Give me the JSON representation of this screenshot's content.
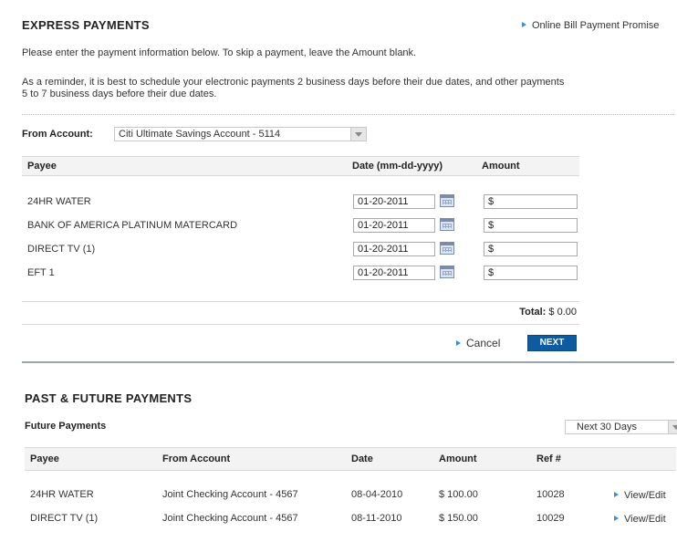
{
  "express": {
    "title": "EXPRESS PAYMENTS",
    "promise_link": "Online Bill Payment Promise",
    "instructions": "Please enter the payment information below. To skip a payment, leave the Amount blank.",
    "reminder_line1": "As a reminder, it is best to schedule your electronic payments 2 business days before their due dates, and other payments",
    "reminder_line2": "5 to 7 business days before their due dates.",
    "from_account_label": "From Account:",
    "from_account_value": "Citi Ultimate Savings Account - 5114",
    "columns": {
      "payee": "Payee",
      "date": "Date (mm-dd-yyyy)",
      "amount": "Amount"
    },
    "rows": [
      {
        "payee": "24HR WATER",
        "date": "01-20-2011",
        "amount": "$"
      },
      {
        "payee": "BANK OF AMERICA PLATINUM MATERCARD",
        "date": "01-20-2011",
        "amount": "$"
      },
      {
        "payee": "DIRECT TV (1)",
        "date": "01-20-2011",
        "amount": "$"
      },
      {
        "payee": "EFT 1",
        "date": "01-20-2011",
        "amount": "$"
      }
    ],
    "total_label": "Total:",
    "total_value": "$ 0.00",
    "cancel_label": "Cancel",
    "next_label": "NEXT"
  },
  "past_future": {
    "title": "PAST & FUTURE PAYMENTS",
    "subtitle": "Future Payments",
    "range_value": "Next 30 Days",
    "columns": {
      "payee": "Payee",
      "from_account": "From Account",
      "date": "Date",
      "amount": "Amount",
      "ref": "Ref #"
    },
    "rows": [
      {
        "payee": "24HR WATER",
        "from_account": "Joint Checking Account - 4567",
        "date": "08-04-2010",
        "amount": "$ 100.00",
        "ref": "10028",
        "action": "View/Edit"
      },
      {
        "payee": "DIRECT TV (1)",
        "from_account": "Joint Checking Account - 4567",
        "date": "08-11-2010",
        "amount": "$ 150.00",
        "ref": "10029",
        "action": "View/Edit"
      }
    ]
  },
  "colors": {
    "accent": "#3a8fd4",
    "button": "#0f5b9f",
    "header_bg": "#f3f3f3"
  },
  "icons": {
    "calendar": "calendar-icon",
    "link_arrow": "triangle-right-icon",
    "dropdown": "chevron-down-icon"
  }
}
